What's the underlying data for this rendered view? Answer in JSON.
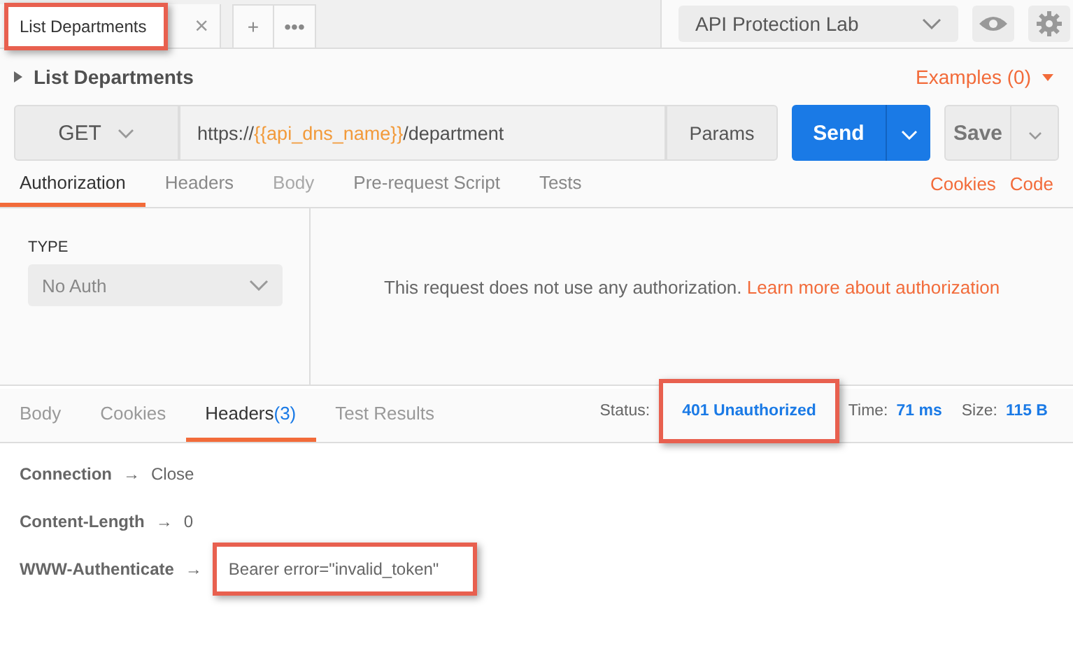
{
  "tabs": [
    {
      "label": "List Departments",
      "highlighted": true,
      "close": "×"
    }
  ],
  "tab_actions": [
    "+",
    "•••"
  ],
  "environment": {
    "value": "API Protection Lab"
  },
  "request": {
    "name": "List Departments",
    "examples": "Examples (0)",
    "method": "GET",
    "url_prefix": "https://",
    "url_variable": "{{api_dns_name}}",
    "url_suffix": "/department",
    "params": "Params",
    "send": "Send",
    "save": "Save"
  },
  "request_tabs": [
    {
      "label": "Authorization",
      "selected": true,
      "disabled": false
    },
    {
      "label": "Headers",
      "selected": false,
      "disabled": false
    },
    {
      "label": "Body",
      "selected": false,
      "disabled": true
    },
    {
      "label": "Pre-request Script",
      "selected": false,
      "disabled": false
    },
    {
      "label": "Tests",
      "selected": false,
      "disabled": false
    }
  ],
  "request_links": [
    "Cookies",
    "Code"
  ],
  "auth": {
    "type_label": "TYPE",
    "type_value": "No Auth",
    "message": "This request does not use any authorization.",
    "link": "Learn more about authorization"
  },
  "response_tabs": [
    {
      "label": "Body",
      "selected": false
    },
    {
      "label": "Cookies",
      "selected": false
    },
    {
      "label": "Headers",
      "count": "(3)",
      "selected": true
    },
    {
      "label": "Test Results",
      "selected": false
    }
  ],
  "response_stats": [
    {
      "label": "Status:",
      "value": "401 Unauthorized",
      "highlighted": true
    },
    {
      "label": "Time:",
      "value": "71 ms",
      "highlighted": false
    },
    {
      "label": "Size:",
      "value": "115 B",
      "highlighted": false
    }
  ],
  "headers": [
    {
      "key": "Connection",
      "arrow": "→",
      "value": "Close",
      "highlighted": false
    },
    {
      "key": "Content-Length",
      "arrow": "→",
      "value": "0",
      "highlighted": false
    },
    {
      "key": "WWW-Authenticate",
      "arrow": "→",
      "value": "Bearer error=\"invalid_token\"",
      "highlighted": true
    }
  ]
}
